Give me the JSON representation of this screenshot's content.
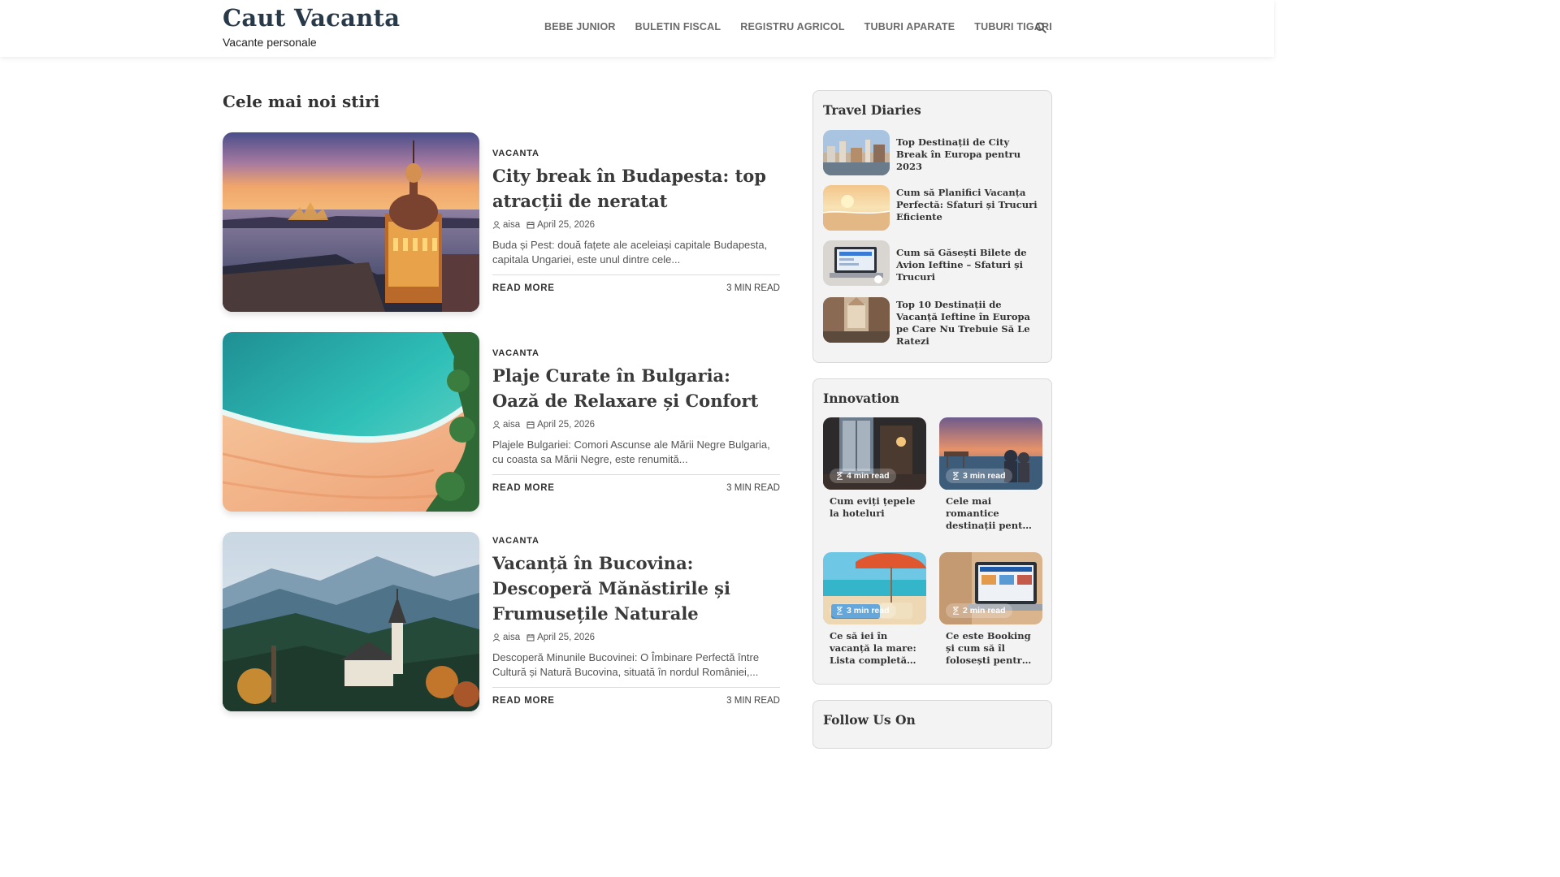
{
  "header": {
    "site_title": "Caut Vacanta",
    "tagline": "Vacante personale",
    "nav": [
      "BEBE JUNIOR",
      "BULETIN FISCAL",
      "REGISTRU AGRICOL",
      "TUBURI APARATE",
      "TUBURI TIGARI"
    ],
    "search_icon": "search-icon"
  },
  "main": {
    "section_title": "Cele mai noi stiri",
    "posts": [
      {
        "category": "VACANTA",
        "title": "City break în Budapesta: top atracții de neratat",
        "author": "aisa",
        "date": "April 25, 2026",
        "excerpt": "Buda și Pest: două fațete ale aceleiași capitale Budapesta, capitala Ungariei, este unul dintre cele...",
        "read_more": "READ MORE",
        "read_time": "3 MIN READ"
      },
      {
        "category": "VACANTA",
        "title": "Plaje Curate în Bulgaria: Oază de Relaxare și Confort",
        "author": "aisa",
        "date": "April 25, 2026",
        "excerpt": "Plajele Bulgariei: Comori Ascunse ale Mării Negre Bulgaria, cu coasta sa Mării Negre, este renumită...",
        "read_more": "READ MORE",
        "read_time": "3 MIN READ"
      },
      {
        "category": "VACANTA",
        "title": "Vacanță în Bucovina: Descoperă Mănăstirile și Frumusețile Naturale",
        "author": "aisa",
        "date": "April 25, 2026",
        "excerpt": "Descoperă Minunile Bucovinei: O Îmbinare Perfectă între Cultură și Natură Bucovina, situată în nordul României,...",
        "read_more": "READ MORE",
        "read_time": "3 MIN READ"
      }
    ]
  },
  "sidebar": {
    "travel_diaries": {
      "title": "Travel Diaries",
      "items": [
        "Top Destinații de City Break în Europa pentru 2023",
        "Cum să Planifici Vacanța Perfectă: Sfaturi și Trucuri Eficiente",
        "Cum să Găsești Bilete de Avion Ieftine – Sfaturi și Trucuri",
        "Top 10 Destinații de Vacanță Ieftine în Europa pe Care Nu Trebuie Să Le Ratezi"
      ]
    },
    "innovation": {
      "title": "Innovation",
      "items": [
        {
          "badge": "4 min read",
          "title": "Cum eviți țepele la hoteluri"
        },
        {
          "badge": "3 min read",
          "title": "Cele mai romantice destinații pentru luna de miere"
        },
        {
          "badge": "3 min read",
          "title": "Ce să iei în vacanță la mare: Lista completă pentru ..."
        },
        {
          "badge": "2 min read",
          "title": "Ce este Booking și cum să îl folosești pentru a-ți..."
        }
      ]
    },
    "follow_title": "Follow Us On"
  },
  "colors": {
    "title": "#283a4a",
    "nav": "#6b6b6b",
    "widget_bg": "#f3f3f3",
    "border": "#d8d8d8"
  }
}
